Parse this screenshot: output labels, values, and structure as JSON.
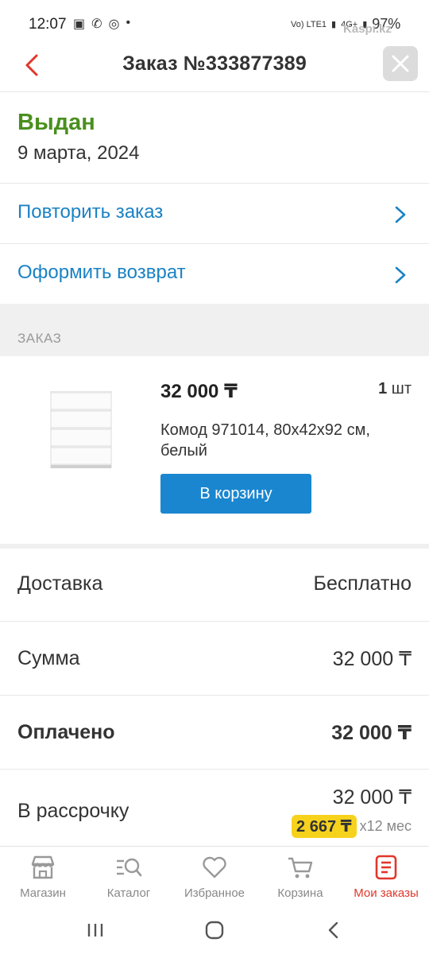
{
  "statusbar": {
    "time": "12:07",
    "network_label": "Vo) LTE1",
    "signal_label": "4G+",
    "battery": "97%",
    "watermark": "Kaspi.kz"
  },
  "header": {
    "title": "Заказ №333877389"
  },
  "order": {
    "status": "Выдан",
    "date": "9 марта, 2024",
    "status_color": "#4a8f1e"
  },
  "actions": {
    "repeat_label": "Повторить заказ",
    "return_label": "Оформить возврат"
  },
  "section": {
    "title": "ЗАКАЗ"
  },
  "product": {
    "price": "32 000 ₸",
    "quantity": "1",
    "quantity_unit": "шт",
    "name": "Комод 971014, 80x42x92 см, белый",
    "cart_button": "В корзину"
  },
  "summary": {
    "delivery_label": "Доставка",
    "delivery_value": "Бесплатно",
    "sum_label": "Сумма",
    "sum_value": "32 000 ₸",
    "paid_label": "Оплачено",
    "paid_value": "32 000 ₸",
    "installment_label": "В рассрочку",
    "installment_value": "32 000 ₸",
    "installment_monthly": "2 667 ₸",
    "installment_term": "x12 мес"
  },
  "nav": {
    "items": [
      {
        "label": "Магазин",
        "icon": "shop-icon"
      },
      {
        "label": "Каталог",
        "icon": "catalog-search-icon"
      },
      {
        "label": "Избранное",
        "icon": "heart-icon"
      },
      {
        "label": "Корзина",
        "icon": "cart-icon"
      },
      {
        "label": "Мои заказы",
        "icon": "orders-icon",
        "active": true
      }
    ]
  },
  "colors": {
    "accent_blue": "#1a82c4",
    "button_blue": "#1a86d0",
    "active_red": "#e0372b",
    "installment_yellow": "#f7d21c"
  }
}
